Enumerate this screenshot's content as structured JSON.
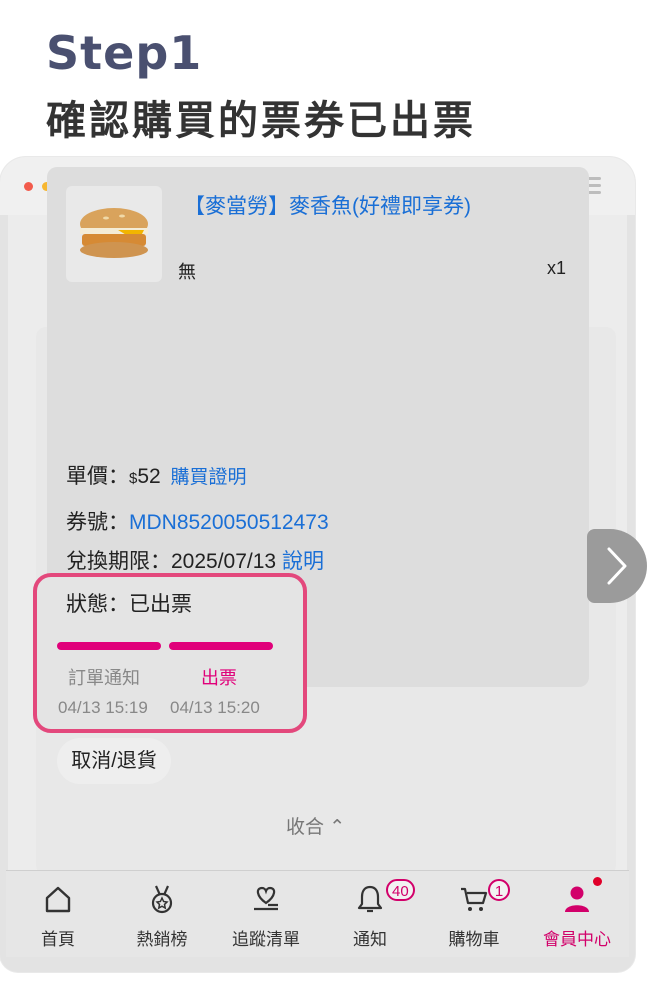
{
  "header": {
    "step": "Step1",
    "subtitle": "確認購買的票券已出票"
  },
  "browser": {
    "dots": [
      "#f25b4c",
      "#f7b731",
      "#3cc352"
    ]
  },
  "product": {
    "name": "【麥當勞】麥香魚(好禮即享券)",
    "spec": "無",
    "qty": "x1"
  },
  "details": {
    "price_label": "單價：",
    "currency": "$",
    "price": "52",
    "receipt_link": "購買證明",
    "code_label": "券號：",
    "code": "MDN8520050512473",
    "expiry_label": "兌換期限：",
    "expiry": "2025/07/13",
    "expiry_link": "說明"
  },
  "status": {
    "label": "狀態：已出票",
    "steps": [
      {
        "name": "訂單通知",
        "time": "04/13 15:19",
        "active": false
      },
      {
        "name": "出票",
        "time": "04/13 15:20",
        "active": true
      }
    ]
  },
  "actions": {
    "cancel": "取消/退貨",
    "collapse": "收合 ⌃"
  },
  "nav": [
    {
      "label": "首頁",
      "icon": "home-icon"
    },
    {
      "label": "熱銷榜",
      "icon": "medal-icon"
    },
    {
      "label": "追蹤清單",
      "icon": "heart-list-icon"
    },
    {
      "label": "通知",
      "icon": "bell-icon",
      "badge": "40"
    },
    {
      "label": "購物車",
      "icon": "cart-icon",
      "badge": "1"
    },
    {
      "label": "會員中心",
      "icon": "member-icon",
      "active": true
    }
  ],
  "colors": {
    "accent": "#e0007a",
    "link": "#1a6fd6",
    "highlight": "#e3487c"
  }
}
